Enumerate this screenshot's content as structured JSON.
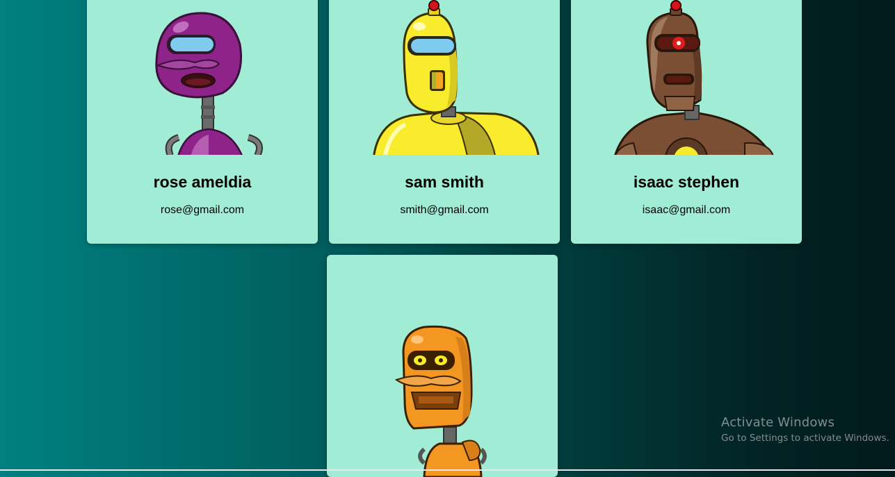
{
  "robots": [
    {
      "name": "rose ameldia",
      "email": "rose@gmail.com",
      "color": "#8e248a",
      "image": "purple-robot"
    },
    {
      "name": "sam smith",
      "email": "smith@gmail.com",
      "color": "#f9ec2d",
      "image": "yellow-robot"
    },
    {
      "name": "isaac stephen",
      "email": "isaac@gmail.com",
      "color": "#7a4f33",
      "image": "brown-robot"
    },
    {
      "image": "orange-robot",
      "color": "#f39622"
    }
  ],
  "watermark": {
    "title": "Activate Windows",
    "subtitle": "Go to Settings to activate Windows."
  },
  "colors": {
    "card_background": "#a1ecd4",
    "background_gradient_start": "#008080",
    "background_gradient_end": "#021a1b"
  }
}
